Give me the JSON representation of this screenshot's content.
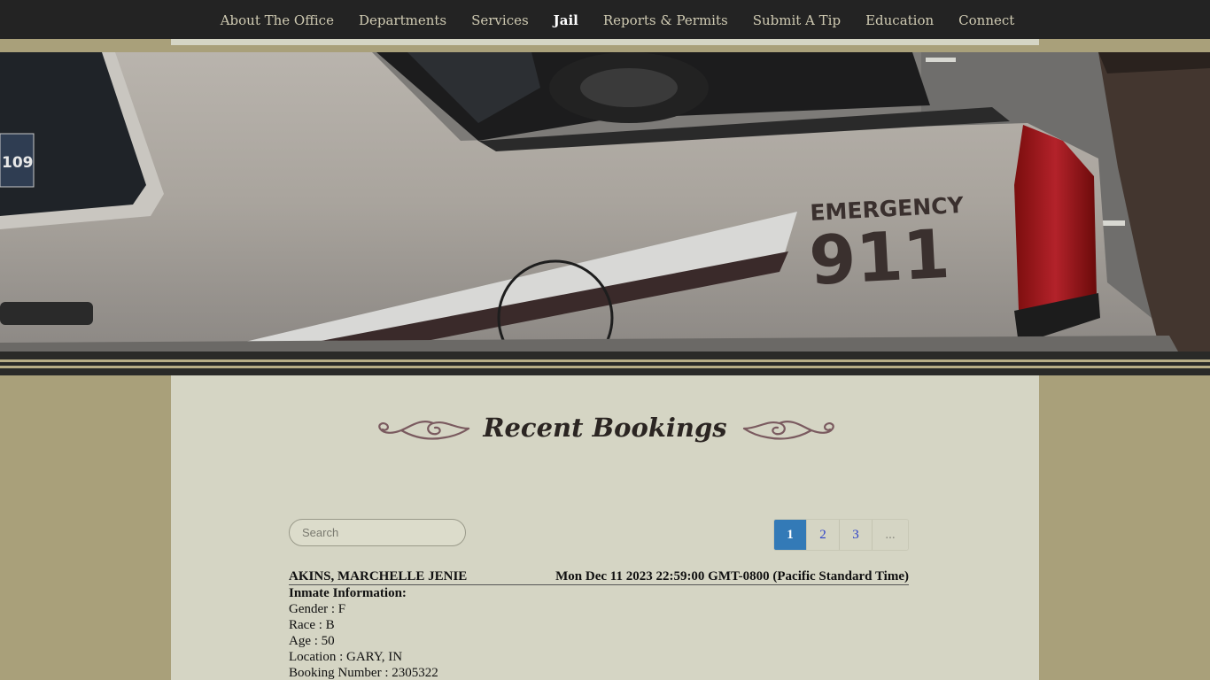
{
  "nav": {
    "items": [
      {
        "label": "About The Office",
        "active": false
      },
      {
        "label": "Departments",
        "active": false
      },
      {
        "label": "Services",
        "active": false
      },
      {
        "label": "Jail",
        "active": true
      },
      {
        "label": "Reports & Permits",
        "active": false
      },
      {
        "label": "Submit A Tip",
        "active": false
      },
      {
        "label": "Education",
        "active": false
      },
      {
        "label": "Connect",
        "active": false
      }
    ]
  },
  "hero": {
    "decal_word": "EMERGENCY",
    "decal_number": "911",
    "sticker_text": "109"
  },
  "main": {
    "title": "Recent Bookings",
    "search": {
      "placeholder": "Search",
      "value": ""
    },
    "pagination": {
      "pages": [
        "1",
        "2",
        "3",
        "..."
      ],
      "current": "1"
    },
    "records": [
      {
        "name": "AKINS, MARCHELLE JENIE",
        "booking_date": "Mon Dec 11 2023 22:59:00 GMT-0800 (Pacific Standard Time)",
        "section_label": "Inmate Information:",
        "gender": "Gender : F",
        "race": "Race : B",
        "age": "Age : 50",
        "location": "Location : GARY, IN",
        "booking_number": "Booking Number : 2305322"
      }
    ]
  },
  "colors": {
    "nav_bg": "#232323",
    "page_bg": "#a9a07a",
    "content_bg": "#d5d5c4",
    "active_page": "#337ab7",
    "title": "#2b2522",
    "flourish": "#7a5a5f"
  }
}
